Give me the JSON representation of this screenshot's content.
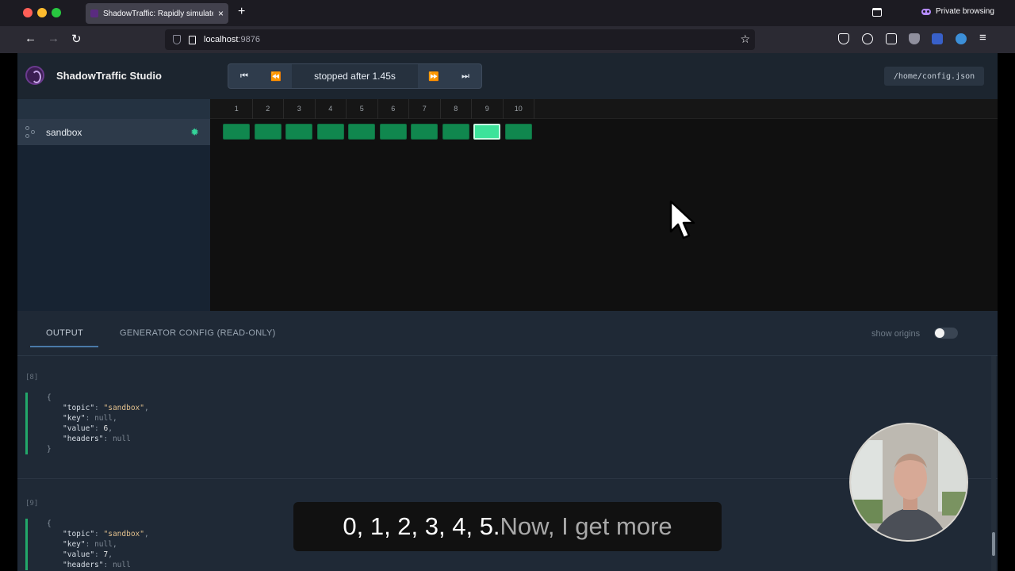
{
  "browser": {
    "tab_title": "ShadowTraffic: Rapidly simulate",
    "tab_close": "×",
    "new_tab": "+",
    "private_label": "Private browsing",
    "url_host": "localhost",
    "url_port": ":9876",
    "back": "←",
    "forward": "→",
    "reload": "↻",
    "star": "☆"
  },
  "app": {
    "title": "ShadowTraffic Studio",
    "config_path": "/home/config.json"
  },
  "controls": {
    "first": "⏮",
    "rewind": "⏪",
    "status": "stopped after 1.45s",
    "forward": "⏩",
    "last": "⏭"
  },
  "sidebar": {
    "items": [
      {
        "label": "sandbox",
        "icon": "node-icon",
        "settings_icon": "gear-icon"
      }
    ]
  },
  "timeline": {
    "ticks": [
      "1",
      "2",
      "3",
      "4",
      "5",
      "6",
      "7",
      "8",
      "9",
      "10"
    ],
    "active_index": 8,
    "cell_color": "#10874e",
    "active_color": "#3de39a"
  },
  "panel": {
    "tabs": [
      {
        "label": "OUTPUT",
        "active": true
      },
      {
        "label": "GENERATOR CONFIG (READ-ONLY)",
        "active": false
      }
    ],
    "show_origins_label": "show origins",
    "show_origins_on": false
  },
  "records": [
    {
      "index": "[8]",
      "topic": "\"sandbox\"",
      "key": "null",
      "value": "6",
      "headers": "null"
    },
    {
      "index": "[9]",
      "topic": "\"sandbox\"",
      "key": "null",
      "value": "7",
      "headers": "null"
    }
  ],
  "caption": {
    "spoken": "0, 1, 2, 3, 4, 5.",
    "upcoming": " Now, I get more"
  }
}
